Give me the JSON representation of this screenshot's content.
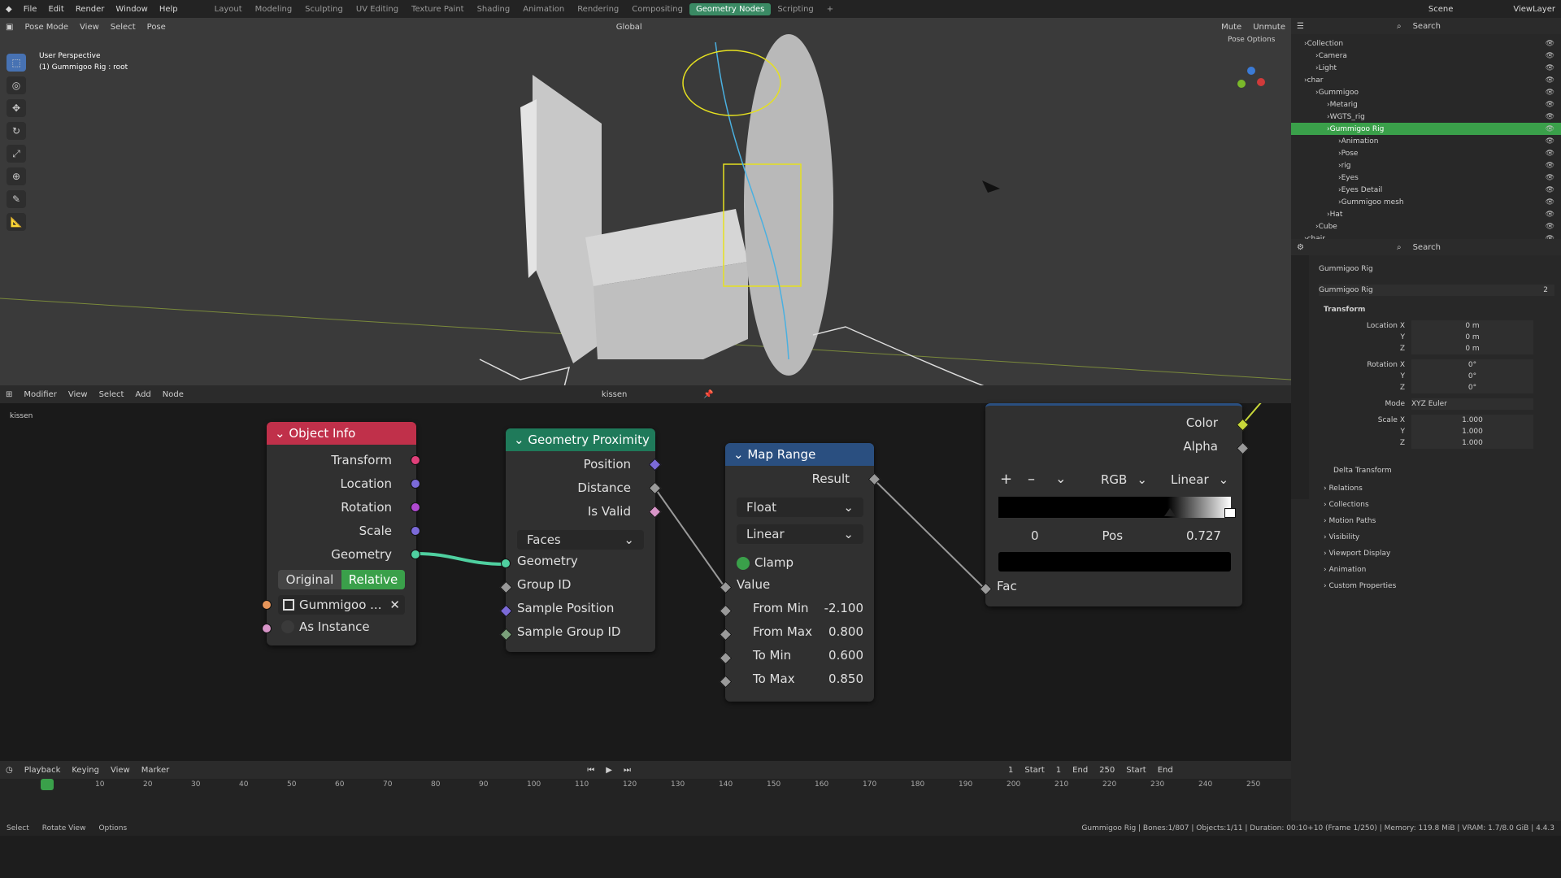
{
  "topbar": {
    "menus": [
      "File",
      "Edit",
      "Render",
      "Window",
      "Help"
    ],
    "workspaces": [
      "Layout",
      "Modeling",
      "Sculpting",
      "UV Editing",
      "Texture Paint",
      "Shading",
      "Animation",
      "Rendering",
      "Compositing",
      "Geometry Nodes",
      "Scripting"
    ],
    "scene": "Scene",
    "view_layer": "ViewLayer"
  },
  "viewport": {
    "mode": "Pose Mode",
    "menus": [
      "View",
      "Select",
      "Pose"
    ],
    "orientation": "Global",
    "overlay_title": "User Perspective",
    "overlay_sub": "(1) Gummigoo Rig : root",
    "mute": "Mute",
    "unmute": "Unmute",
    "pose_options": "Pose Options"
  },
  "node_editor": {
    "type": "Modifier",
    "menus": [
      "View",
      "Select",
      "Add",
      "Node"
    ],
    "tree_name": "kissen",
    "breadcrumb": "kissen"
  },
  "nodes": {
    "object_info": {
      "title": "Object Info",
      "outputs": [
        "Transform",
        "Location",
        "Rotation",
        "Scale",
        "Geometry"
      ],
      "toggle": [
        "Original",
        "Relative"
      ],
      "object": "Gummigoo ...",
      "as_instance": "As Instance"
    },
    "geo_prox": {
      "title": "Geometry Proximity",
      "outputs": [
        "Position",
        "Distance",
        "Is Valid"
      ],
      "mode": "Faces",
      "inputs": [
        "Geometry",
        "Group ID",
        "Sample Position",
        "Sample Group ID"
      ]
    },
    "map_range": {
      "title": "Map Range",
      "output": "Result",
      "type": "Float",
      "interp": "Linear",
      "clamp": "Clamp",
      "value": "Value",
      "fields": [
        {
          "label": "From Min",
          "value": "-2.100"
        },
        {
          "label": "From Max",
          "value": "0.800"
        },
        {
          "label": "To Min",
          "value": "0.600"
        },
        {
          "label": "To Max",
          "value": "0.850"
        }
      ]
    },
    "color_ramp": {
      "outputs": [
        "Color",
        "Alpha"
      ],
      "color_mode": "RGB",
      "interp": "Linear",
      "index": "0",
      "pos_label": "Pos",
      "pos": "0.727",
      "fac": "Fac",
      "btn_add": "+",
      "btn_remove": "–",
      "btn_menu": "⌄"
    }
  },
  "timeline": {
    "menus": [
      "Playback",
      "Keying",
      "View",
      "Marker"
    ],
    "current": "1",
    "start_label": "Start",
    "start": "1",
    "end_label": "End",
    "end": "250",
    "ticks": [
      "1",
      "10",
      "20",
      "30",
      "40",
      "50",
      "60",
      "70",
      "80",
      "90",
      "100",
      "110",
      "120",
      "130",
      "140",
      "150",
      "160",
      "170",
      "180",
      "190",
      "200",
      "210",
      "220",
      "230",
      "240",
      "250"
    ],
    "start_btn": "Start",
    "end_btn": "End"
  },
  "status": {
    "left": [
      "Select",
      "Rotate View",
      "Options"
    ],
    "right": "Gummigoo Rig | Bones:1/807 | Objects:1/11 | Duration: 00:10+10 (Frame 1/250) | Memory: 119.8 MiB | VRAM: 1.7/8.0 GiB | 4.4.3"
  },
  "outliner": {
    "search": "Search",
    "items": [
      {
        "label": "Collection",
        "depth": 0
      },
      {
        "label": "Camera",
        "depth": 1
      },
      {
        "label": "Light",
        "depth": 1
      },
      {
        "label": "char",
        "depth": 0
      },
      {
        "label": "Gummigoo",
        "depth": 1
      },
      {
        "label": "Metarig",
        "depth": 2
      },
      {
        "label": "WGTS_rig",
        "depth": 2
      },
      {
        "label": "Gummigoo Rig",
        "depth": 2,
        "selected": true
      },
      {
        "label": "Animation",
        "depth": 3
      },
      {
        "label": "Pose",
        "depth": 3
      },
      {
        "label": "rig",
        "depth": 3
      },
      {
        "label": "Eyes",
        "depth": 3
      },
      {
        "label": "Eyes Detail",
        "depth": 3
      },
      {
        "label": "Gummigoo mesh",
        "depth": 3
      },
      {
        "label": "Hat",
        "depth": 2
      },
      {
        "label": "Cube",
        "depth": 1
      },
      {
        "label": "chair",
        "depth": 0
      }
    ]
  },
  "properties": {
    "search": "Search",
    "object": "Gummigoo Rig",
    "data_name": "Gummigoo Rig",
    "users": "2",
    "transform": "Transform",
    "rows": [
      {
        "label": "Location X",
        "value": "0 m"
      },
      {
        "label": "Y",
        "value": "0 m"
      },
      {
        "label": "Z",
        "value": "0 m"
      },
      {
        "label": "Rotation X",
        "value": "0°"
      },
      {
        "label": "Y",
        "value": "0°"
      },
      {
        "label": "Z",
        "value": "0°"
      },
      {
        "label": "Mode",
        "value": "XYZ Euler"
      },
      {
        "label": "Scale X",
        "value": "1.000"
      },
      {
        "label": "Y",
        "value": "1.000"
      },
      {
        "label": "Z",
        "value": "1.000"
      }
    ],
    "delta": "Delta Transform",
    "panels": [
      "Relations",
      "Collections",
      "Motion Paths",
      "Visibility",
      "Viewport Display",
      "Animation",
      "Custom Properties"
    ]
  },
  "colors": {
    "accent": "#3a8a64",
    "obj_info": "#c0304a",
    "geo_prox": "#1f7a5a",
    "map_range": "#2a4f80",
    "green_link": "#4fd0a0",
    "selected_row": "#3aa04a"
  }
}
